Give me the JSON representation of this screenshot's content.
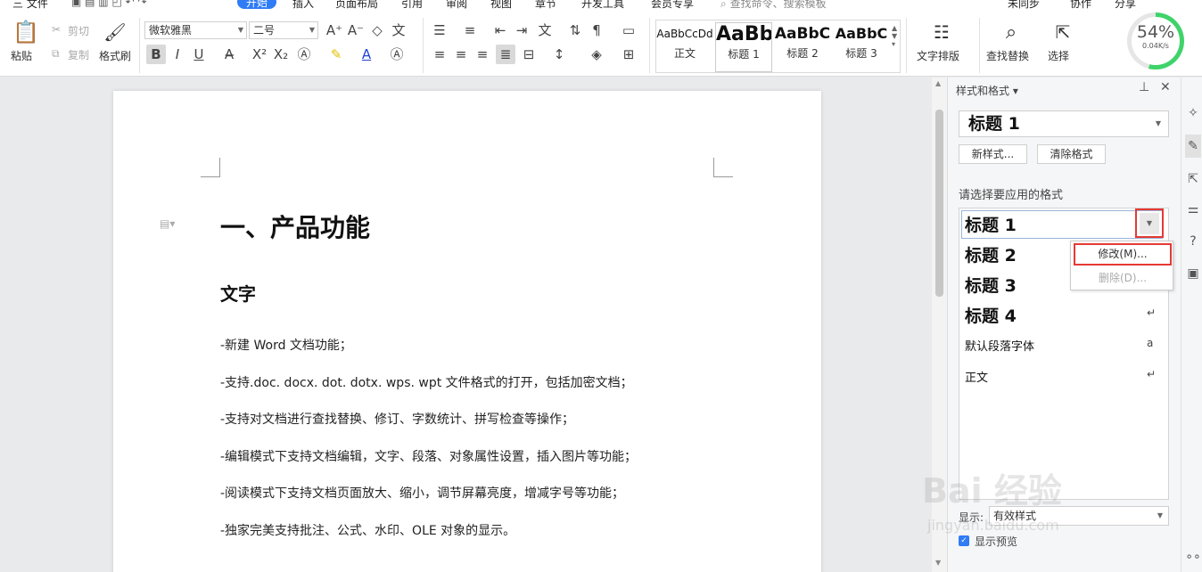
{
  "menu": {
    "file": "三 文件",
    "tabs": [
      "开始",
      "插入",
      "页面布局",
      "引用",
      "审阅",
      "视图",
      "章节",
      "开发工具",
      "会员专享"
    ],
    "search_placeholder": "查找命令、搜索模板",
    "unsynced": "未同步",
    "collab": "协作",
    "share": "分享"
  },
  "ribbon": {
    "paste": "粘贴",
    "cut": "剪切",
    "copy": "复制",
    "format_painter": "格式刷",
    "font_name": "微软雅黑",
    "font_size": "二号",
    "styles": [
      {
        "preview": "AaBbCcDd",
        "caption": "正文"
      },
      {
        "preview": "AaBb",
        "caption": "标题 1"
      },
      {
        "preview": "AaBbC",
        "caption": "标题 2"
      },
      {
        "preview": "AaBbC",
        "caption": "标题 3"
      }
    ],
    "text_layout": "文字排版",
    "find_replace": "查找替换",
    "select": "选择"
  },
  "speed": {
    "percent": "54%",
    "rate": "0.04K/s"
  },
  "document": {
    "heading1": "一、产品功能",
    "heading2": "文字",
    "paragraphs": [
      "-新建 Word 文档功能；",
      "-支持.doc. docx. dot. dotx. wps. wpt  文件格式的打开，包括加密文档；",
      "-支持对文档进行查找替换、修订、字数统计、拼写检查等操作；",
      "-编辑模式下支持文档编辑，文字、段落、对象属性设置，插入图片等功能；",
      "-阅读模式下支持文档页面放大、缩小，调节屏幕亮度，增减字号等功能；",
      "-独家完美支持批注、公式、水印、OLE 对象的显示。"
    ]
  },
  "pane": {
    "title": "样式和格式 ▾",
    "current_style": "标题  1",
    "new_style": "新样式...",
    "clear_format": "清除格式",
    "choose_label": "请选择要应用的格式",
    "list": [
      {
        "name": "标题  1",
        "mark": ""
      },
      {
        "name": "标题  2",
        "mark": ""
      },
      {
        "name": "标题  3",
        "mark": ""
      },
      {
        "name": "标题  4",
        "mark": "↵"
      },
      {
        "name": "默认段落字体",
        "mark": "a"
      },
      {
        "name": "正文",
        "mark": "↵"
      }
    ],
    "context_menu": {
      "modify": "修改(M)...",
      "delete": "删除(D)..."
    },
    "show_label": "显示:",
    "show_value": "有效样式",
    "preview_label": "显示预览"
  },
  "watermark": {
    "main": "Bai 经验",
    "sub": "jingyan.baidu.com"
  }
}
